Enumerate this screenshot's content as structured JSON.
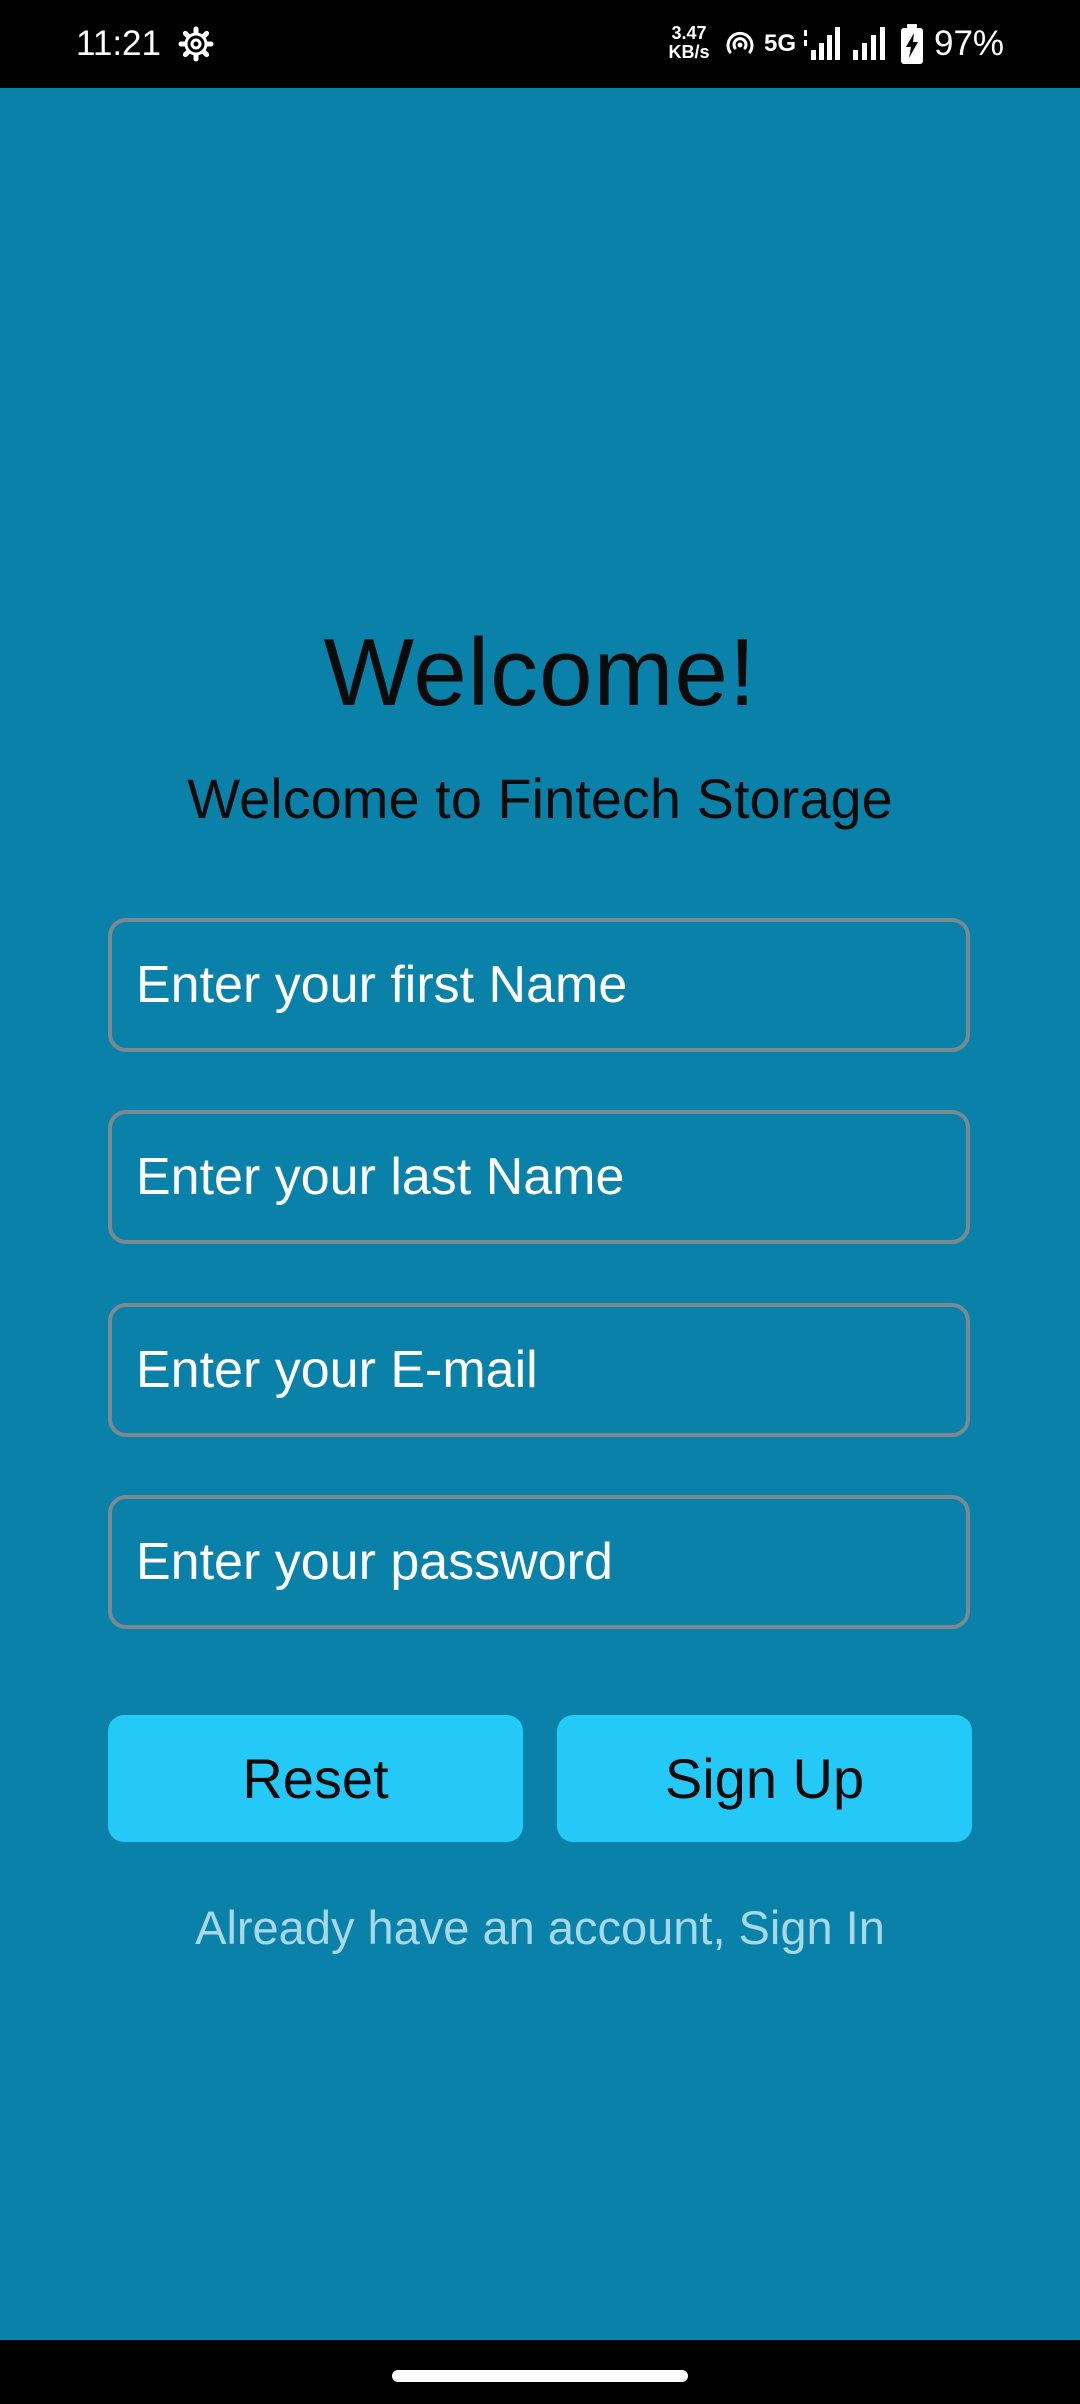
{
  "status_bar": {
    "time": "11:21",
    "settings_icon": "gear-icon",
    "net_speed_value": "3.47",
    "net_speed_unit": "KB/s",
    "network_type": "5G",
    "battery": "97%"
  },
  "header": {
    "title": "Welcome!",
    "subtitle": "Welcome to Fintech Storage"
  },
  "form": {
    "first_name": {
      "placeholder": "Enter your first Name",
      "value": ""
    },
    "last_name": {
      "placeholder": "Enter your last Name",
      "value": ""
    },
    "email": {
      "placeholder": "Enter your E-mail",
      "value": ""
    },
    "password": {
      "placeholder": "Enter your password",
      "value": ""
    }
  },
  "actions": {
    "reset_label": "Reset",
    "signup_label": "Sign Up",
    "signin_link": "Already have an account, Sign In"
  },
  "colors": {
    "background": "#0981a8",
    "button": "#24c9f8",
    "link": "#a6d8ea",
    "field_border": "#7b8a90"
  }
}
